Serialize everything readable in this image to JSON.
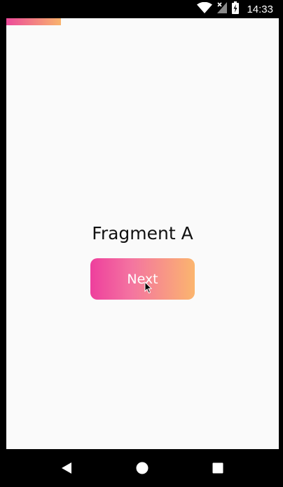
{
  "status_bar": {
    "time": "14:33",
    "icons": [
      "wifi-icon",
      "signal-off-icon",
      "battery-charging-icon"
    ]
  },
  "progress": {
    "fraction": 0.2,
    "colors": [
      "#ec4a9a",
      "#f9b46d"
    ]
  },
  "main": {
    "title": "Fragment A",
    "next_label": "Next"
  },
  "navigation": {
    "buttons": [
      "back-icon",
      "home-icon",
      "recents-icon"
    ]
  },
  "colors": {
    "gradient_start": "#ee3f9d",
    "gradient_end": "#fbb56e",
    "background": "#fafafa"
  }
}
